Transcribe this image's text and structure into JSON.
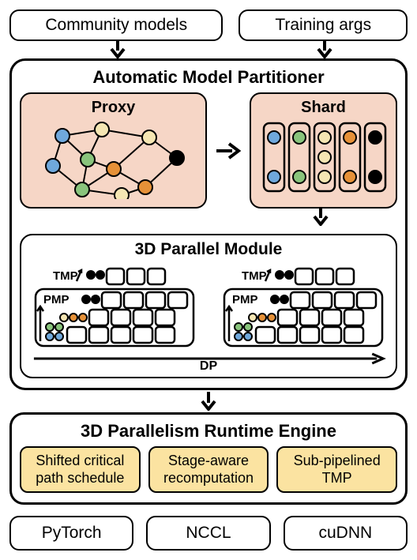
{
  "top": {
    "left": "Community models",
    "right": "Training args"
  },
  "partitioner": {
    "title": "Automatic Model Partitioner",
    "proxy": "Proxy",
    "shard": "Shard",
    "parallel_module": {
      "title": "3D Parallel Module",
      "tmp": "TMP",
      "pmp": "PMP",
      "dp": "DP"
    }
  },
  "runtime": {
    "title": "3D Parallelism Runtime Engine",
    "items": [
      "Shifted critical path schedule",
      "Stage-aware recomputation",
      "Sub-pipelined TMP"
    ]
  },
  "bottom": [
    "PyTorch",
    "NCCL",
    "cuDNN"
  ],
  "colors": {
    "blue": "#6fa8dc",
    "green": "#89c47c",
    "beige": "#f5e6b3",
    "orange": "#e69138",
    "black": "#000"
  }
}
